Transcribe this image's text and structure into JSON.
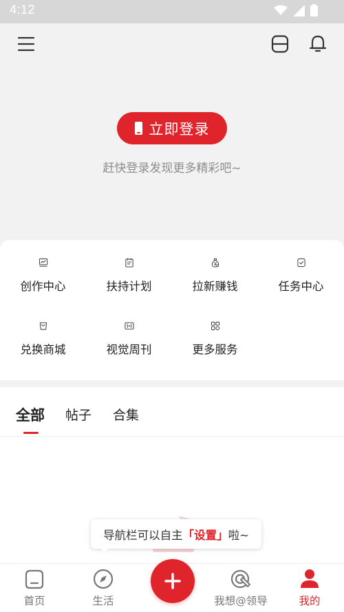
{
  "status_bar": {
    "time": "4:12",
    "icons": [
      "wifi-icon",
      "signal-icon",
      "battery-icon"
    ]
  },
  "top_bar": {
    "left_icon": "menu-icon",
    "right_icons": [
      "scan-icon",
      "bell-icon"
    ]
  },
  "login": {
    "button_label": "立即登录",
    "hint": "赶快登录发现更多精彩吧~"
  },
  "features": [
    {
      "label": "创作中心",
      "icon": "chart-monitor-icon"
    },
    {
      "label": "扶持计划",
      "icon": "clipboard-icon"
    },
    {
      "label": "拉新赚钱",
      "icon": "money-bag-icon"
    },
    {
      "label": "任务中心",
      "icon": "task-check-icon"
    },
    {
      "label": "兑换商城",
      "icon": "shopping-bag-icon"
    },
    {
      "label": "视觉周刊",
      "icon": "broadcast-icon"
    },
    {
      "label": "更多服务",
      "icon": "grid-icon"
    }
  ],
  "tabs": [
    {
      "label": "全部",
      "active": true
    },
    {
      "label": "帖子",
      "active": false
    },
    {
      "label": "合集",
      "active": false
    }
  ],
  "tooltip": {
    "before": "导航栏可以自主",
    "highlight": "「设置」",
    "after": "啦~"
  },
  "bottom_nav": [
    {
      "label": "首页",
      "icon": "home-icon",
      "active": false
    },
    {
      "label": "生活",
      "icon": "compass-icon",
      "active": false
    },
    {
      "label": "我想@领导",
      "icon": "target-pen-icon",
      "active": false
    },
    {
      "label": "我的",
      "icon": "person-icon",
      "active": true
    }
  ],
  "colors": {
    "accent": "#e0242c",
    "background": "#f2f2f2",
    "panel": "#ffffff"
  }
}
